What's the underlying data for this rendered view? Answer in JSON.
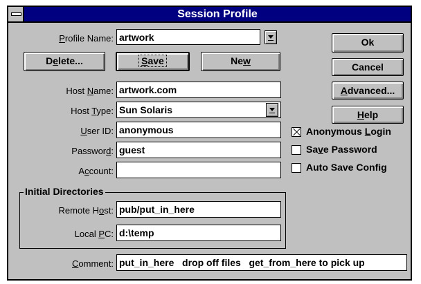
{
  "window": {
    "title": "Session Profile"
  },
  "profile": {
    "label_pre": "",
    "label_u": "P",
    "label_post": "rofile Name:",
    "value": "artwork"
  },
  "buttons": {
    "delete": {
      "pre": "D",
      "u": "e",
      "post": "lete..."
    },
    "save": {
      "pre": "",
      "u": "S",
      "post": "ave"
    },
    "new": {
      "pre": "Ne",
      "u": "w",
      "post": ""
    },
    "ok": "Ok",
    "cancel": "Cancel",
    "advanced": {
      "pre": "",
      "u": "A",
      "post": "dvanced..."
    },
    "help": {
      "pre": "",
      "u": "H",
      "post": "elp"
    }
  },
  "host_name": {
    "pre": "Host ",
    "u": "N",
    "post": "ame:",
    "value": "artwork.com"
  },
  "host_type": {
    "pre": "Host ",
    "u": "T",
    "post": "ype:",
    "value": "Sun Solaris"
  },
  "user_id": {
    "pre": "",
    "u": "U",
    "post": "ser ID:",
    "value": "anonymous"
  },
  "password": {
    "pre": "Passwor",
    "u": "d",
    "post": ":",
    "value": "guest"
  },
  "account": {
    "pre": "A",
    "u": "c",
    "post": "count:",
    "value": ""
  },
  "checkboxes": {
    "anonymous": {
      "pre": "Anonymous ",
      "u": "L",
      "post": "ogin",
      "checked": true
    },
    "save_password": {
      "pre": "Sa",
      "u": "v",
      "post": "e Password",
      "checked": false
    },
    "auto_save": {
      "pre": "Auto Save Config",
      "u": "",
      "post": "",
      "checked": false
    }
  },
  "initial_directories": {
    "title": "Initial Directories",
    "remote": {
      "pre": "Remote H",
      "u": "o",
      "post": "st:",
      "value": "pub/put_in_here"
    },
    "local": {
      "pre": "Local ",
      "u": "P",
      "post": "C:",
      "value": "d:\\temp"
    }
  },
  "comment": {
    "pre": "",
    "u": "C",
    "post": "omment:",
    "value": "put_in_here   drop off files   get_from_here to pick up"
  }
}
